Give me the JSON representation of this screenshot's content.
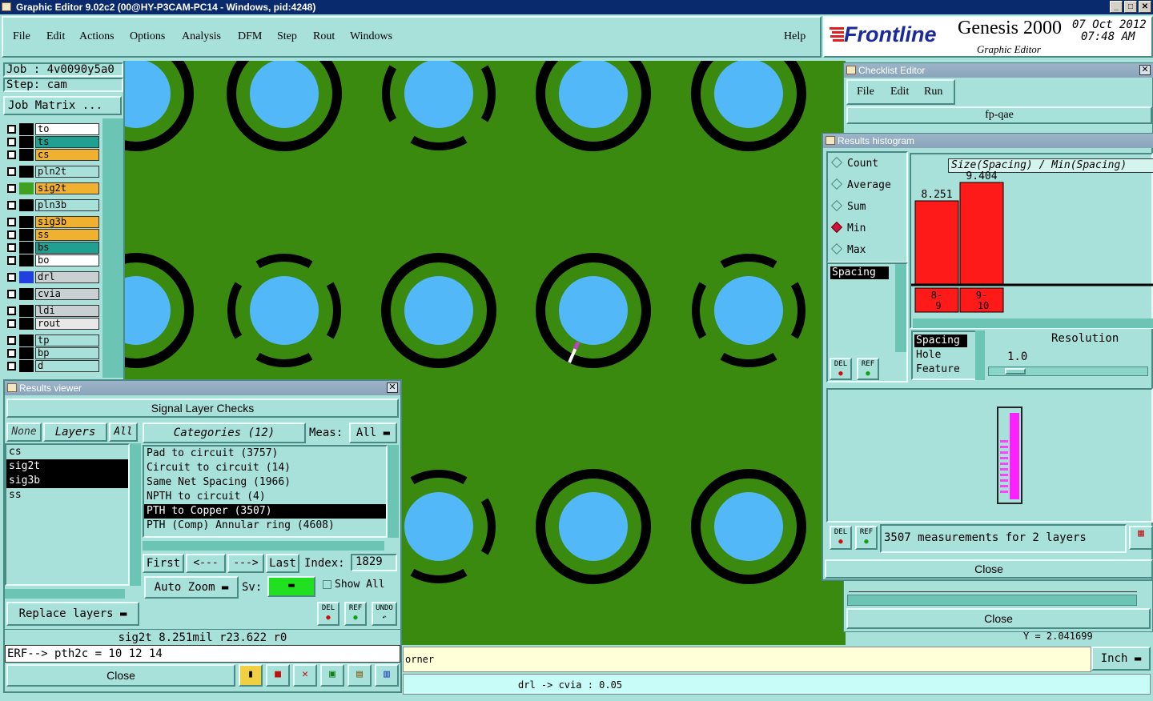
{
  "window_title": "Graphic Editor 9.02c2 (00@HY-P3CAM-PC14 - Windows, pid:4248)",
  "menu": [
    "File",
    "Edit",
    "Actions",
    "Options",
    "Analysis",
    "DFM",
    "Step",
    "Rout",
    "Windows"
  ],
  "help_label": "Help",
  "brand": {
    "logo": "Frontline",
    "product": "Genesis 2000",
    "subtitle": "Graphic Editor",
    "date": "07 Oct 2012",
    "time": "07:48 AM"
  },
  "job": {
    "job": "Job : 4v0090y5a0",
    "step": "Step: cam",
    "matrix_button": "Job Matrix ..."
  },
  "layers": [
    {
      "name": "to",
      "color": "#ffffff",
      "swatch": "#000000"
    },
    {
      "name": "ts",
      "color": "#20a090",
      "swatch": "#000000"
    },
    {
      "name": "cs",
      "color": "#f0b030",
      "swatch": "#000000"
    },
    {
      "name": "pln2t",
      "color": "#a8e0da",
      "swatch": "#000000"
    },
    {
      "name": "sig2t",
      "color": "#f0b030",
      "swatch": "#40a020"
    },
    {
      "name": "pln3b",
      "color": "#a8e0da",
      "swatch": "#000000"
    },
    {
      "name": "sig3b",
      "color": "#f0b030",
      "swatch": "#000000"
    },
    {
      "name": "ss",
      "color": "#f0b030",
      "swatch": "#000000"
    },
    {
      "name": "bs",
      "color": "#20a090",
      "swatch": "#000000"
    },
    {
      "name": "bo",
      "color": "#ffffff",
      "swatch": "#000000"
    },
    {
      "name": "drl",
      "color": "#c8d0d4",
      "swatch": "#2040e0"
    },
    {
      "name": "cvia",
      "color": "#c8d0d4",
      "swatch": "#000000"
    },
    {
      "name": "ldi",
      "color": "#c8d0d4",
      "swatch": "#000000"
    },
    {
      "name": "rout",
      "color": "#e8e8e8",
      "swatch": "#000000"
    },
    {
      "name": "tp",
      "color": "#a8e0da",
      "swatch": "#000000"
    },
    {
      "name": "bp",
      "color": "#a8e0da",
      "swatch": "#000000"
    },
    {
      "name": "d",
      "color": "#a8e0da",
      "swatch": "#000000"
    }
  ],
  "results_viewer": {
    "title": "Results viewer",
    "header": "Signal Layer Checks",
    "none_label": "None",
    "layers_label": "Layers",
    "all_label": "All",
    "layer_list": [
      "cs",
      "sig2t",
      "sig3b",
      "ss"
    ],
    "categories_label": "Categories (12)",
    "meas_label": "Meas:",
    "meas_value": "All",
    "categories": [
      "Pad to circuit (3757)",
      "Circuit to circuit (14)",
      "Same Net Spacing (1966)",
      "NPTH to circuit (4)",
      "PTH to Copper (3507)",
      "PTH (Comp) Annular ring (4608)"
    ],
    "first": "First",
    "prev": "<---",
    "next": "--->",
    "last": "Last",
    "index_label": "Index:",
    "index_value": "1829",
    "auto_zoom": "Auto Zoom",
    "sv_label": "Sv:",
    "show_all": "Show All",
    "replace_layers": "Replace layers",
    "status_line": "sig2t 8.251mil  r23.622  r0",
    "erf_line": "ERF--> pth2c = 10 12 14",
    "close": "Close",
    "del": "DEL",
    "ref": "REF",
    "undo": "UNDO"
  },
  "checklist_editor": {
    "title": "Checklist Editor",
    "menu": [
      "File",
      "Edit",
      "Run"
    ],
    "name": "fp-qae",
    "close": "Close"
  },
  "histogram": {
    "title": "Results histogram",
    "modes": [
      "Count",
      "Average",
      "Sum",
      "Min",
      "Max"
    ],
    "selected_mode": "Min",
    "measure_list": [
      "Spacing"
    ],
    "type_list": [
      "Spacing",
      "Hole",
      "Feature"
    ],
    "resolution_label": "Resolution",
    "resolution_value": "1.0",
    "measurements": "3507 measurements for 2 layers",
    "close": "Close",
    "del": "DEL",
    "ref": "REF"
  },
  "chart_data": {
    "type": "bar",
    "title": "Size(Spacing) / Min(Spacing)",
    "categories": [
      "8-9",
      "9-10"
    ],
    "values": [
      8.251,
      9.404
    ],
    "data_labels": [
      "8.251",
      "9.404"
    ],
    "bin_labels": [
      "8-\n9",
      "9-\n10"
    ],
    "bar_color": "#ff1a1a"
  },
  "bottom": {
    "message": "orner",
    "units": "Inch",
    "status": "drl -> cvia : 0.05",
    "y_coord": "Y = 2.041699"
  }
}
